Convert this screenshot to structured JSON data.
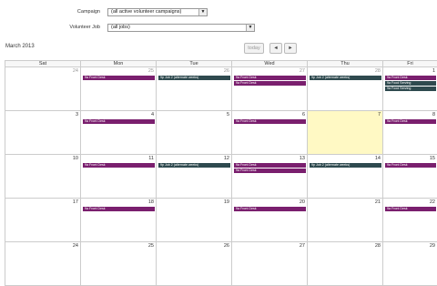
{
  "filters": {
    "campaign_label": "Campaign",
    "campaign_value": "(all active volunteer campaigns)",
    "job_label": "Volunteer Job",
    "job_value": "(all jobs)"
  },
  "calendar": {
    "month_title": "March 2013",
    "today_label": "today",
    "prev_label": "◄",
    "next_label": "►",
    "days_of_week": [
      "Sat",
      "Mon",
      "Tue",
      "Wed",
      "Thu",
      "Fri"
    ],
    "weeks": [
      {
        "days": [
          {
            "num": "24",
            "other": true,
            "events": []
          },
          {
            "num": "25",
            "other": true,
            "events": [
              {
                "text": "9a Front Desk",
                "color": "purple"
              }
            ]
          },
          {
            "num": "26",
            "other": true,
            "events": [
              {
                "text": "9p Job 2 (alternate weeks)",
                "color": "teal"
              }
            ]
          },
          {
            "num": "27",
            "other": true,
            "events": [
              {
                "text": "9a Front Desk",
                "color": "purple"
              },
              {
                "text": "9a Front Desk",
                "color": "purple"
              }
            ]
          },
          {
            "num": "28",
            "other": true,
            "events": [
              {
                "text": "9p Job 2 (alternate weeks)",
                "color": "teal"
              }
            ]
          },
          {
            "num": "1",
            "other": false,
            "events": [
              {
                "text": "9a Front Desk",
                "color": "purple"
              },
              {
                "text": "9a Food Serving",
                "color": "teal"
              },
              {
                "text": "9a Food Serving",
                "color": "teal"
              }
            ]
          }
        ]
      },
      {
        "days": [
          {
            "num": "3",
            "other": false,
            "events": []
          },
          {
            "num": "4",
            "other": false,
            "events": [
              {
                "text": "9a Front Desk",
                "color": "purple"
              }
            ]
          },
          {
            "num": "5",
            "other": false,
            "events": []
          },
          {
            "num": "6",
            "other": false,
            "events": [
              {
                "text": "9a Front Desk",
                "color": "purple"
              }
            ]
          },
          {
            "num": "7",
            "other": false,
            "today": true,
            "events": []
          },
          {
            "num": "8",
            "other": false,
            "events": [
              {
                "text": "9a Front Desk",
                "color": "purple"
              }
            ]
          }
        ]
      },
      {
        "days": [
          {
            "num": "10",
            "other": false,
            "events": []
          },
          {
            "num": "11",
            "other": false,
            "events": [
              {
                "text": "9a Front Desk",
                "color": "purple"
              }
            ]
          },
          {
            "num": "12",
            "other": false,
            "events": [
              {
                "text": "9p Job 2 (alternate weeks)",
                "color": "teal"
              }
            ]
          },
          {
            "num": "13",
            "other": false,
            "events": [
              {
                "text": "9a Front Desk",
                "color": "purple"
              },
              {
                "text": "9a Front Desk",
                "color": "purple"
              }
            ]
          },
          {
            "num": "14",
            "other": false,
            "events": [
              {
                "text": "9p Job 2 (alternate weeks)",
                "color": "teal"
              }
            ]
          },
          {
            "num": "15",
            "other": false,
            "events": [
              {
                "text": "9a Front Desk",
                "color": "purple"
              }
            ]
          }
        ]
      },
      {
        "days": [
          {
            "num": "17",
            "other": false,
            "events": []
          },
          {
            "num": "18",
            "other": false,
            "events": [
              {
                "text": "9a Front Desk",
                "color": "purple"
              }
            ]
          },
          {
            "num": "19",
            "other": false,
            "events": []
          },
          {
            "num": "20",
            "other": false,
            "events": [
              {
                "text": "9a Front Desk",
                "color": "purple"
              }
            ]
          },
          {
            "num": "21",
            "other": false,
            "events": []
          },
          {
            "num": "22",
            "other": false,
            "events": [
              {
                "text": "9a Front Desk",
                "color": "purple"
              }
            ]
          }
        ]
      },
      {
        "days": [
          {
            "num": "24",
            "other": false,
            "events": []
          },
          {
            "num": "25",
            "other": false,
            "events": []
          },
          {
            "num": "26",
            "other": false,
            "events": []
          },
          {
            "num": "27",
            "other": false,
            "events": []
          },
          {
            "num": "28",
            "other": false,
            "events": []
          },
          {
            "num": "29",
            "other": false,
            "events": []
          }
        ]
      }
    ]
  },
  "colors": {
    "event_purple": "#7a1f6e",
    "event_teal": "#2f4a4f",
    "today_bg": "#fff9c4"
  }
}
